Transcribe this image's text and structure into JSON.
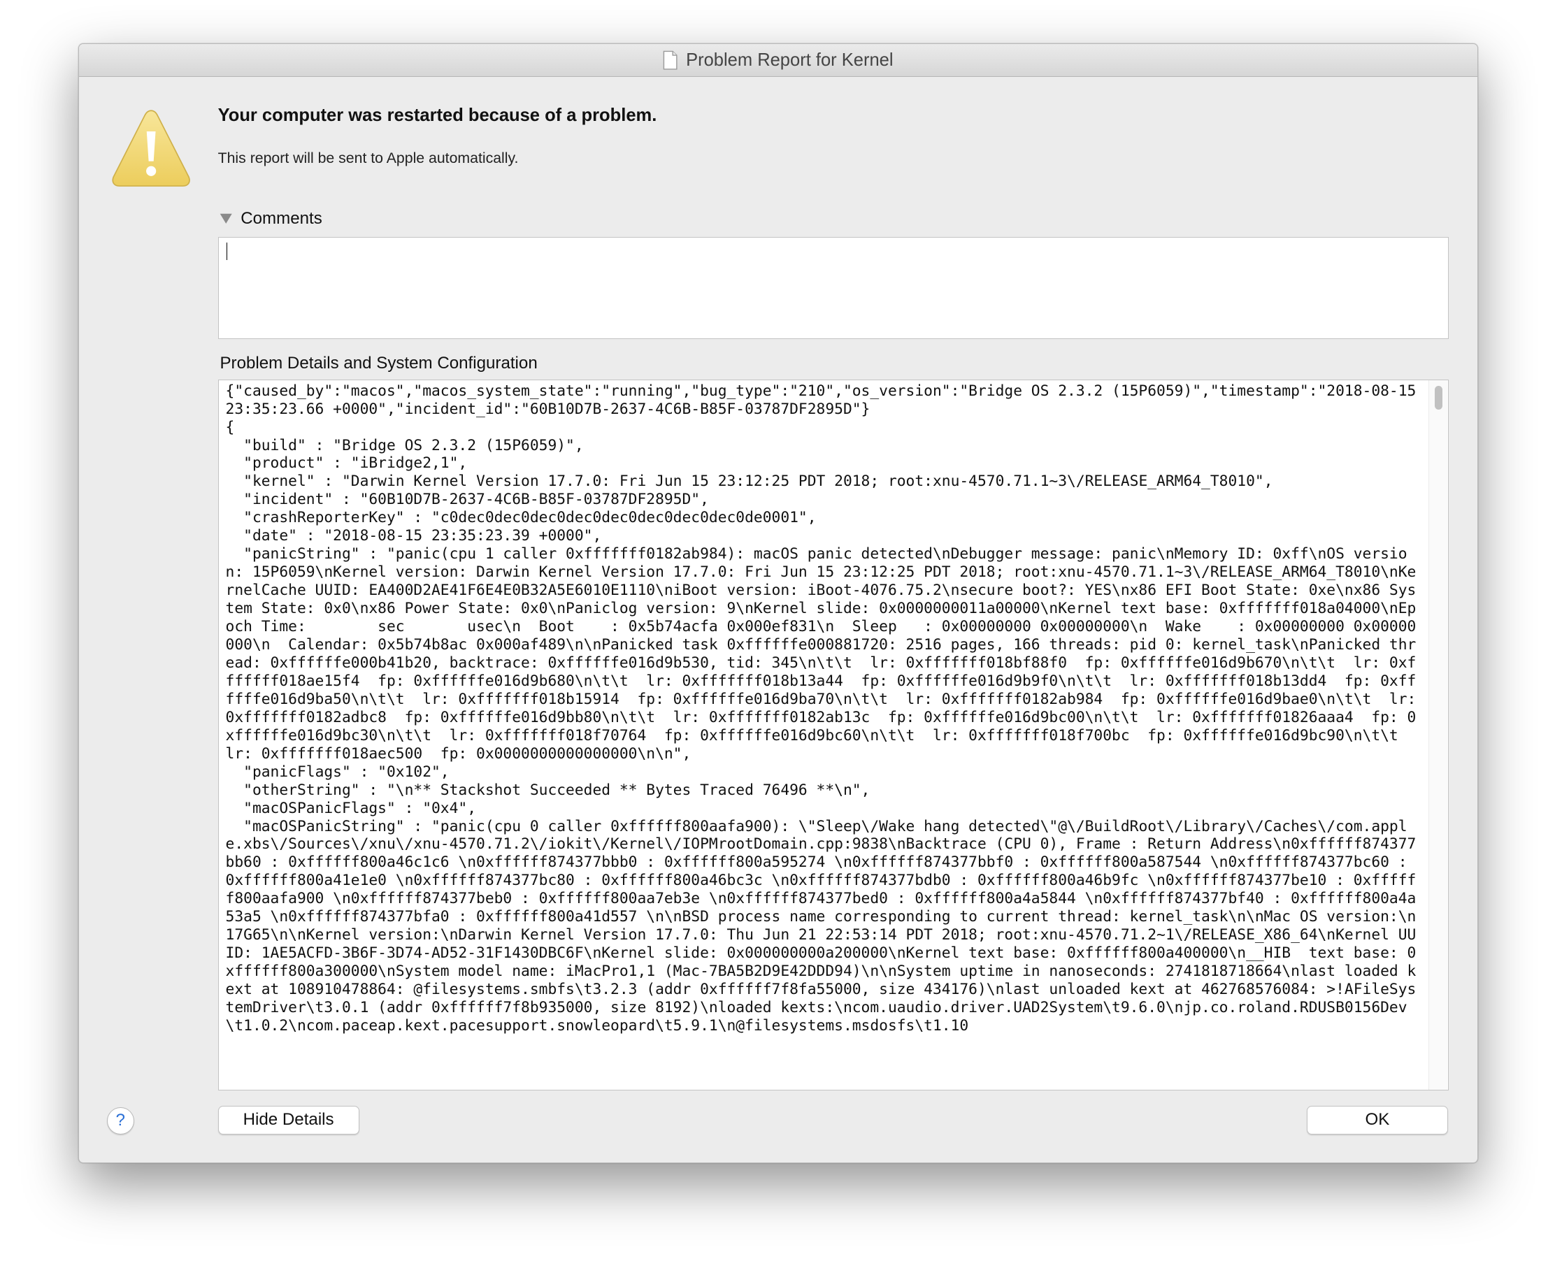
{
  "window": {
    "title": "Problem Report for Kernel"
  },
  "alert": {
    "headline": "Your computer was restarted because of a problem.",
    "subtext": "This report will be sent to Apple automatically."
  },
  "comments": {
    "label": "Comments",
    "value": ""
  },
  "details": {
    "label": "Problem Details and System Configuration",
    "text": "{\"caused_by\":\"macos\",\"macos_system_state\":\"running\",\"bug_type\":\"210\",\"os_version\":\"Bridge OS 2.3.2 (15P6059)\",\"timestamp\":\"2018-08-15 23:35:23.66 +0000\",\"incident_id\":\"60B10D7B-2637-4C6B-B85F-03787DF2895D\"}\n{\n  \"build\" : \"Bridge OS 2.3.2 (15P6059)\",\n  \"product\" : \"iBridge2,1\",\n  \"kernel\" : \"Darwin Kernel Version 17.7.0: Fri Jun 15 23:12:25 PDT 2018; root:xnu-4570.71.1~3\\/RELEASE_ARM64_T8010\",\n  \"incident\" : \"60B10D7B-2637-4C6B-B85F-03787DF2895D\",\n  \"crashReporterKey\" : \"c0dec0dec0dec0dec0dec0dec0dec0dec0de0001\",\n  \"date\" : \"2018-08-15 23:35:23.39 +0000\",\n  \"panicString\" : \"panic(cpu 1 caller 0xfffffff0182ab984): macOS panic detected\\nDebugger message: panic\\nMemory ID: 0xff\\nOS version: 15P6059\\nKernel version: Darwin Kernel Version 17.7.0: Fri Jun 15 23:12:25 PDT 2018; root:xnu-4570.71.1~3\\/RELEASE_ARM64_T8010\\nKernelCache UUID: EA400D2AE41F6E4E0B32A5E6010E1110\\niBoot version: iBoot-4076.75.2\\nsecure boot?: YES\\nx86 EFI Boot State: 0xe\\nx86 System State: 0x0\\nx86 Power State: 0x0\\nPaniclog version: 9\\nKernel slide: 0x0000000011a00000\\nKernel text base: 0xfffffff018a04000\\nEpoch Time:        sec       usec\\n  Boot    : 0x5b74acfa 0x000ef831\\n  Sleep   : 0x00000000 0x00000000\\n  Wake    : 0x00000000 0x00000000\\n  Calendar: 0x5b74b8ac 0x000af489\\n\\nPanicked task 0xffffffe000881720: 2516 pages, 166 threads: pid 0: kernel_task\\nPanicked thread: 0xffffffe000b41b20, backtrace: 0xffffffe016d9b530, tid: 345\\n\\t\\t  lr: 0xfffffff018bf88f0  fp: 0xffffffe016d9b670\\n\\t\\t  lr: 0xfffffff018ae15f4  fp: 0xffffffe016d9b680\\n\\t\\t  lr: 0xfffffff018b13a44  fp: 0xffffffe016d9b9f0\\n\\t\\t  lr: 0xfffffff018b13dd4  fp: 0xffffffe016d9ba50\\n\\t\\t  lr: 0xfffffff018b15914  fp: 0xffffffe016d9ba70\\n\\t\\t  lr: 0xfffffff0182ab984  fp: 0xffffffe016d9bae0\\n\\t\\t  lr: 0xfffffff0182adbc8  fp: 0xffffffe016d9bb80\\n\\t\\t  lr: 0xfffffff0182ab13c  fp: 0xffffffe016d9bc00\\n\\t\\t  lr: 0xfffffff01826aaa4  fp: 0xffffffe016d9bc30\\n\\t\\t  lr: 0xfffffff018f70764  fp: 0xffffffe016d9bc60\\n\\t\\t  lr: 0xfffffff018f700bc  fp: 0xffffffe016d9bc90\\n\\t\\t  lr: 0xfffffff018aec500  fp: 0x0000000000000000\\n\\n\",\n  \"panicFlags\" : \"0x102\",\n  \"otherString\" : \"\\n** Stackshot Succeeded ** Bytes Traced 76496 **\\n\",\n  \"macOSPanicFlags\" : \"0x4\",\n  \"macOSPanicString\" : \"panic(cpu 0 caller 0xffffff800aafa900): \\\"Sleep\\/Wake hang detected\\\"@\\/BuildRoot\\/Library\\/Caches\\/com.apple.xbs\\/Sources\\/xnu\\/xnu-4570.71.2\\/iokit\\/Kernel\\/IOPMrootDomain.cpp:9838\\nBacktrace (CPU 0), Frame : Return Address\\n0xffffff874377bb60 : 0xffffff800a46c1c6 \\n0xffffff874377bbb0 : 0xffffff800a595274 \\n0xffffff874377bbf0 : 0xffffff800a587544 \\n0xffffff874377bc60 : 0xffffff800a41e1e0 \\n0xffffff874377bc80 : 0xffffff800a46bc3c \\n0xffffff874377bdb0 : 0xffffff800a46b9fc \\n0xffffff874377be10 : 0xffffff800aafa900 \\n0xffffff874377beb0 : 0xffffff800aa7eb3e \\n0xffffff874377bed0 : 0xffffff800a4a5844 \\n0xffffff874377bf40 : 0xffffff800a4a53a5 \\n0xffffff874377bfa0 : 0xffffff800a41d557 \\n\\nBSD process name corresponding to current thread: kernel_task\\n\\nMac OS version:\\n17G65\\n\\nKernel version:\\nDarwin Kernel Version 17.7.0: Thu Jun 21 22:53:14 PDT 2018; root:xnu-4570.71.2~1\\/RELEASE_X86_64\\nKernel UUID: 1AE5ACFD-3B6F-3D74-AD52-31F1430DBC6F\\nKernel slide: 0x000000000a200000\\nKernel text base: 0xffffff800a400000\\n__HIB  text base: 0xffffff800a300000\\nSystem model name: iMacPro1,1 (Mac-7BA5B2D9E42DDD94)\\n\\nSystem uptime in nanoseconds: 2741818718664\\nlast loaded kext at 108910478864: @filesystems.smbfs\\t3.2.3 (addr 0xffffff7f8fa55000, size 434176)\\nlast unloaded kext at 462768576084: >!AFileSystemDriver\\t3.0.1 (addr 0xffffff7f8b935000, size 8192)\\nloaded kexts:\\ncom.uaudio.driver.UAD2System\\t9.6.0\\njp.co.roland.RDUSB0156Dev\\t1.0.2\\ncom.paceap.kext.pacesupport.snowleopard\\t5.9.1\\n@filesystems.msdosfs\\t1.10"
  },
  "buttons": {
    "help_label": "?",
    "hide_details_label": "Hide Details",
    "ok_label": "OK"
  },
  "icons": {
    "warning": "warning-triangle-icon",
    "document": "document-icon",
    "disclosure": "disclosure-triangle-icon"
  },
  "colors": {
    "warning_fill": "#f2d675",
    "help_accent": "#2a6fd6"
  }
}
